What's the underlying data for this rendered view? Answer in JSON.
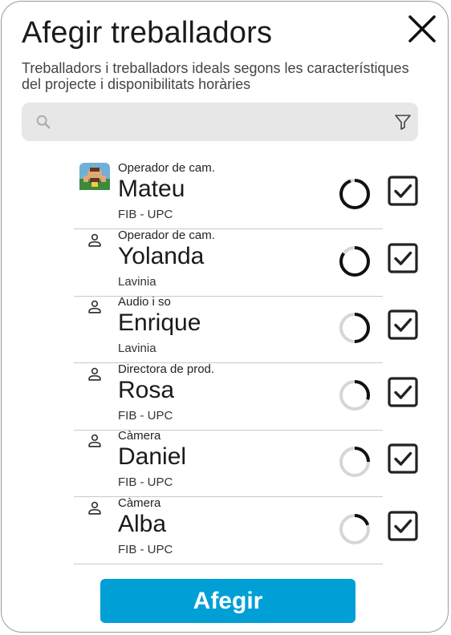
{
  "dialog": {
    "title": "Afegir treballadors",
    "subtitle": "Treballadors i treballadors ideals segons les característiques del projecte i disponibilitats horàries",
    "close_icon": "close-x-icon"
  },
  "search": {
    "value": "",
    "placeholder": "",
    "search_icon": "search-icon",
    "filter_icon": "filter-icon"
  },
  "workers": [
    {
      "role": "Operador de cam.",
      "name": "Mateu",
      "org": "FIB - UPC",
      "avatar": "photo-avatar",
      "availability": 0.95,
      "selected": true
    },
    {
      "role": "Operador de cam.",
      "name": "Yolanda",
      "org": "Lavinia",
      "avatar": "person-icon",
      "availability": 0.85,
      "selected": true
    },
    {
      "role": "Audio i so",
      "name": "Enrique",
      "org": "Lavinia",
      "avatar": "person-icon",
      "availability": 0.5,
      "selected": true
    },
    {
      "role": "Directora de prod.",
      "name": "Rosa",
      "org": "FIB - UPC",
      "avatar": "person-icon",
      "availability": 0.3,
      "selected": true
    },
    {
      "role": "Càmera",
      "name": "Daniel",
      "org": "FIB - UPC",
      "avatar": "person-icon",
      "availability": 0.25,
      "selected": true
    },
    {
      "role": "Càmera",
      "name": "Alba",
      "org": "FIB - UPC",
      "avatar": "person-icon",
      "availability": 0.2,
      "selected": true
    }
  ],
  "footer": {
    "add_label": "Afegir"
  },
  "colors": {
    "accent": "#009fd6",
    "ring_track": "#d6d6d6",
    "ring_fill": "#111111",
    "search_bg": "#e7e7e7"
  }
}
